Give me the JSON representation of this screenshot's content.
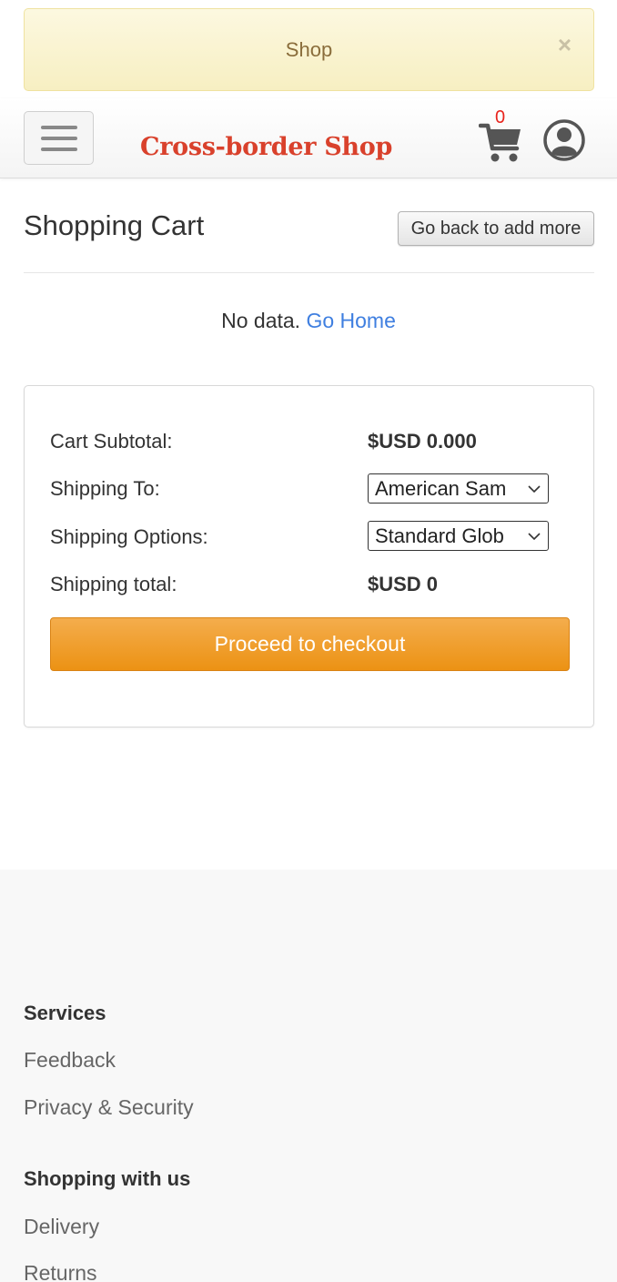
{
  "alert": {
    "text": "Shop",
    "close_symbol": "×"
  },
  "navbar": {
    "brand": "Cross-border Shop",
    "cart_count": "0",
    "icons": {
      "menu": "hamburger-menu-icon",
      "cart": "shopping-cart-icon",
      "account": "user-circle-icon"
    },
    "brand_color": "#d9412c"
  },
  "cart": {
    "title": "Shopping Cart",
    "back_button": "Go back to add more",
    "empty_text": "No data.",
    "go_home_link": "Go Home"
  },
  "summary": {
    "subtotal_label": "Cart Subtotal:",
    "subtotal_value": "$USD 0.000",
    "shipping_to_label": "Shipping To:",
    "shipping_to_value": "American Sam",
    "shipping_options_label": "Shipping Options:",
    "shipping_options_value": "Standard Glob",
    "shipping_total_label": "Shipping total:",
    "shipping_total_value": "$USD 0",
    "checkout_button": "Proceed to checkout",
    "checkout_color": "#ec9214"
  },
  "footer": {
    "sections": [
      {
        "heading": "Services",
        "links": [
          "Feedback",
          "Privacy & Security"
        ]
      },
      {
        "heading": "Shopping with us",
        "links": [
          "Delivery",
          "Returns"
        ]
      }
    ]
  }
}
